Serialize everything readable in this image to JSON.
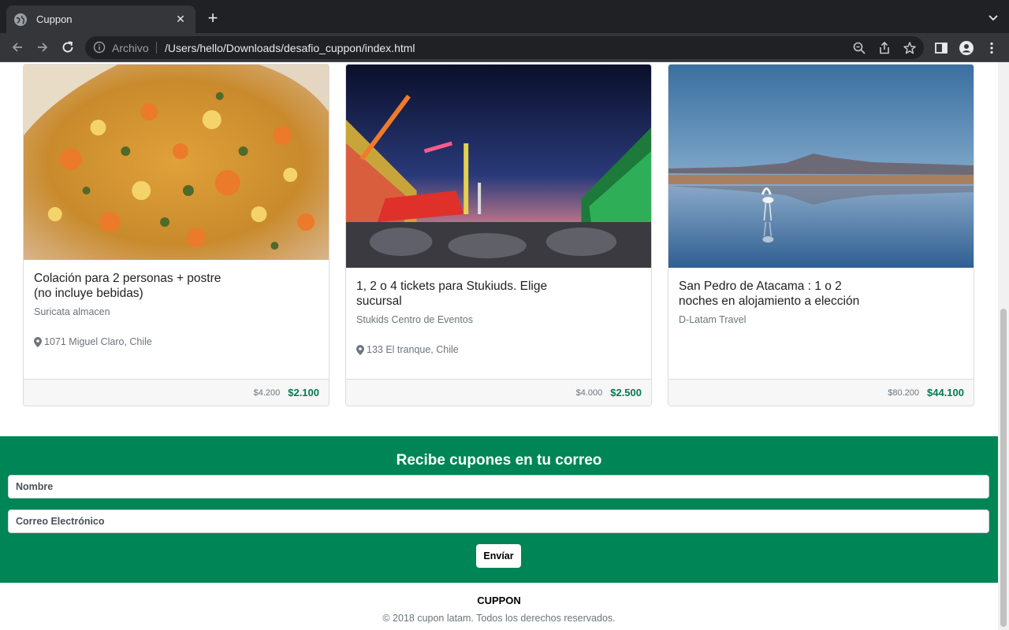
{
  "browser": {
    "tab_title": "Cuppon",
    "tab_close": "✕",
    "new_tab": "+",
    "scheme_label": "Archivo",
    "url": "/Users/hello/Downloads/desafio_cuppon/index.html"
  },
  "cards": [
    {
      "title": "Colación para 2 personas + postre\n(no incluye bebidas)",
      "merchant": "Suricata almacen",
      "location": "1071 Miguel Claro, Chile",
      "old_price": "$4.200",
      "new_price": "$2.100",
      "image": "food-photo"
    },
    {
      "title": "1, 2 o 4 tickets para Stukiuds. Elige\nsucursal",
      "merchant": "Stukids Centro de Eventos",
      "location": "133 El tranque, Chile",
      "old_price": "$4.000",
      "new_price": "$2.500",
      "image": "fair-night-photo"
    },
    {
      "title": "San Pedro de Atacama : 1 o 2\nnoches en alojamiento a elección",
      "merchant": "D-Latam Travel",
      "location": "",
      "old_price": "$80.200",
      "new_price": "$44.100",
      "image": "flamingo-lagoon-photo"
    }
  ],
  "newsletter": {
    "title": "Recibe cupones en tu correo",
    "name_placeholder": "Nombre",
    "email_placeholder": "Correo Electrónico",
    "submit_label": "Envíar"
  },
  "footer": {
    "brand": "CUPPON",
    "copyright": "© 2018 cupon latam. Todos los derechos reservados."
  },
  "colors": {
    "brand_green": "#008556",
    "price_green": "#007b4f",
    "chrome_dark": "#202124"
  }
}
